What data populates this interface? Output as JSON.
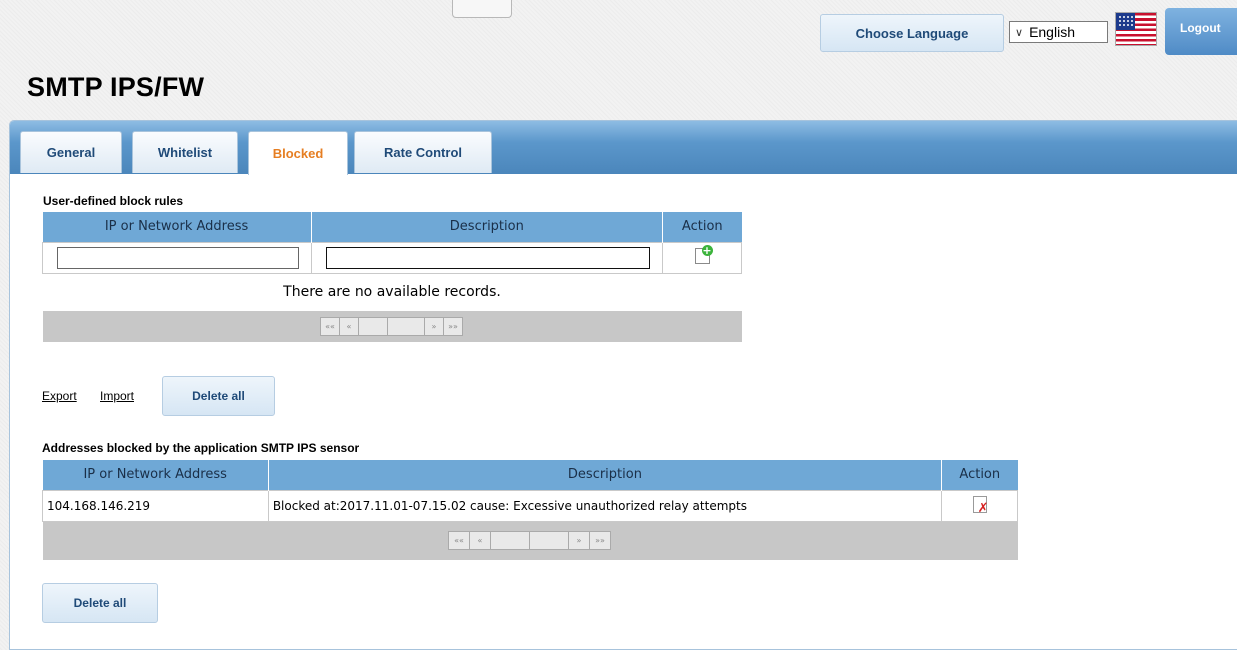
{
  "header": {
    "choose_language": "Choose Language",
    "language_selected": "English",
    "logout": "Logout"
  },
  "page_title": "SMTP IPS/FW",
  "tabs": [
    {
      "label": "General",
      "active": false
    },
    {
      "label": "Whitelist",
      "active": false
    },
    {
      "label": "Blocked",
      "active": true
    },
    {
      "label": "Rate Control",
      "active": false
    }
  ],
  "user_rules": {
    "title": "User-defined block rules",
    "columns": [
      "IP or Network Address",
      "Description",
      "Action"
    ],
    "ip_input_value": "",
    "description_input_value": "",
    "action_icon": "add-record-icon",
    "empty_message": "There are no available records.",
    "pager": [
      "««",
      "«",
      "",
      "",
      "»",
      "»»"
    ]
  },
  "actions": {
    "export": "Export",
    "import": "Import",
    "delete_all": "Delete all"
  },
  "sensor_blocked": {
    "title": "Addresses blocked by the application SMTP IPS sensor",
    "columns": [
      "IP or Network Address",
      "Description",
      "Action"
    ],
    "rows": [
      {
        "ip": "104.168.146.219",
        "description": "Blocked at:2017.11.01-07.15.02 cause: Excessive unauthorized relay attempts",
        "action_icon": "delete-record-icon"
      }
    ],
    "pager": [
      "««",
      "«",
      "",
      "",
      "»",
      "»»"
    ],
    "delete_all": "Delete all"
  },
  "colors": {
    "tab_bar": "#5b97cb",
    "table_header": "#6fa8d6",
    "active_tab_text": "#e67e22",
    "button_text": "#1f4a78"
  }
}
